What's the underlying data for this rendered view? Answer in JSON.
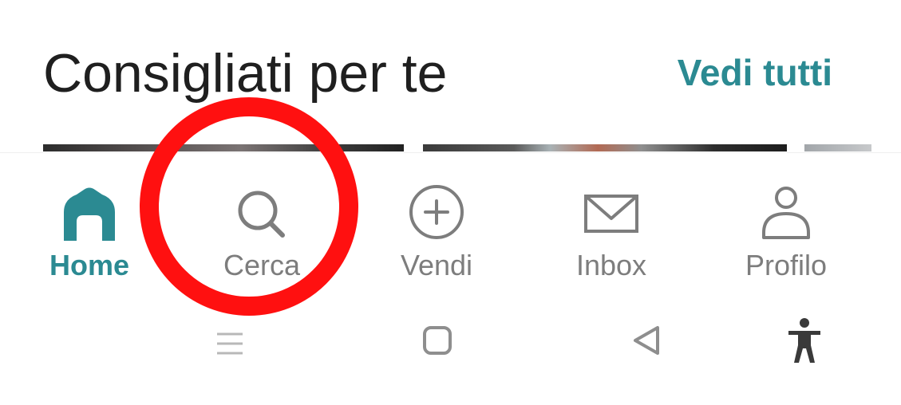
{
  "section": {
    "title": "Consigliati per te",
    "see_all_label": "Vedi tutti"
  },
  "bottom_nav": {
    "items": [
      {
        "label": "Home",
        "icon": "home-icon",
        "active": true
      },
      {
        "label": "Cerca",
        "icon": "search-icon",
        "active": false
      },
      {
        "label": "Vendi",
        "icon": "plus-circle-icon",
        "active": false
      },
      {
        "label": "Inbox",
        "icon": "mail-icon",
        "active": false
      },
      {
        "label": "Profilo",
        "icon": "person-icon",
        "active": false
      }
    ]
  },
  "system_nav": {
    "buttons": [
      "recent-apps-icon",
      "home-square-icon",
      "back-triangle-icon",
      "accessibility-icon"
    ]
  },
  "colors": {
    "accent": "#2b8a92",
    "inactive": "#7d7d7d",
    "highlight": "#ff1010",
    "title": "#1f1f1f"
  }
}
